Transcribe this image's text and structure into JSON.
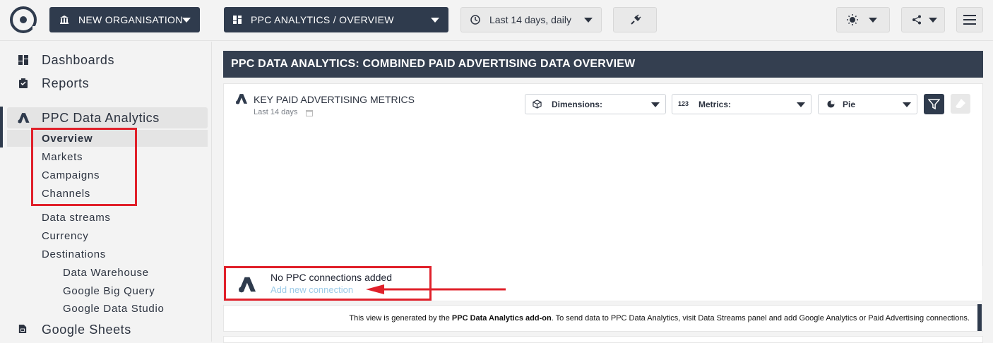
{
  "topbar": {
    "org_label": "NEW ORGANISATION",
    "view_label": "PPC ANALYTICS / OVERVIEW",
    "date_label": "Last 14 days, daily"
  },
  "sidebar": {
    "dashboards": "Dashboards",
    "reports": "Reports",
    "ppc": "PPC Data Analytics",
    "overview": "Overview",
    "markets": "Markets",
    "campaigns": "Campaigns",
    "channels": "Channels",
    "data_streams": "Data streams",
    "currency": "Currency",
    "destinations": "Destinations",
    "data_warehouse": "Data Warehouse",
    "big_query": "Google Big Query",
    "data_studio": "Google Data Studio",
    "sheets": "Google Sheets"
  },
  "main": {
    "page_title": "PPC DATA ANALYTICS: COMBINED PAID ADVERTISING DATA OVERVIEW",
    "widget_title": "KEY PAID ADVERTISING METRICS",
    "widget_subtitle": "Last 14 days",
    "dimensions_label": "Dimensions:",
    "metrics_badge": "123",
    "metrics_label": "Metrics:",
    "chart_type_label": "Pie",
    "no_conn": "No PPC connections added",
    "add_conn": "Add new connection",
    "info_prefix": "This view is generated by the ",
    "info_bold": "PPC Data Analytics add-on",
    "info_suffix": ". To send data to PPC Data Analytics, visit Data Streams panel and add Google Analytics or Paid Advertising connections."
  },
  "colors": {
    "dark": "#2f3b4d",
    "highlight": "#e0202a",
    "link": "#9ccbe8"
  }
}
